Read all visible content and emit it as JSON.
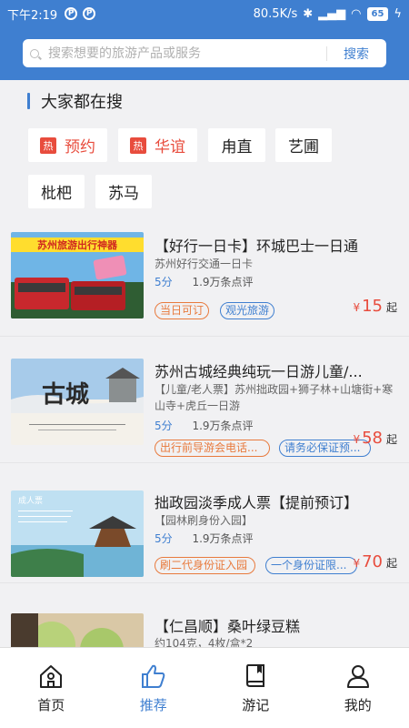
{
  "statusbar": {
    "time": "下午2:19",
    "p1": "P",
    "p2": "P",
    "speed": "80.5K/s",
    "battery": "65"
  },
  "search": {
    "placeholder": "搜索想要的旅游产品或服务",
    "button": "搜索"
  },
  "hot": {
    "title": "大家都在搜",
    "hot_label": "热",
    "chips": [
      "预约",
      "华谊",
      "甪直",
      "艺圃",
      "枇杷",
      "苏马"
    ]
  },
  "items": [
    {
      "title": "【好行一日卡】环城巴士一日通",
      "subtitle": "苏州好行交通一日卡",
      "score": "5分",
      "reviews": "1.9万条点评",
      "tags": [
        "当日可订",
        "观光旅游"
      ],
      "currency": "¥",
      "price": "15",
      "qi": "起",
      "thumb_text": "苏州旅游出行神器"
    },
    {
      "title": "苏州古城经典纯玩一日游儿童/...",
      "subtitle": "【儿童/老人票】苏州拙政园+狮子林+山塘街+寒山寺+虎丘一日游",
      "score": "5分",
      "reviews": "1.9万条点评",
      "tags": [
        "出行前导游会电话...",
        "请务必保证预..."
      ],
      "currency": "¥",
      "price": "58",
      "qi": "起",
      "thumb_text": "古城"
    },
    {
      "title": "拙政园淡季成人票【提前预订】",
      "subtitle": "【园林刷身份入园】",
      "score": "5分",
      "reviews": "1.9万条点评",
      "tags": [
        "刷二代身份证入园",
        "一个身份证限..."
      ],
      "currency": "¥",
      "price": "70",
      "qi": "起",
      "thumb_text": "成人票"
    },
    {
      "title": "【仁昌顺】桑叶绿豆糕",
      "subtitle": "约104克，4枚/盒*2"
    }
  ],
  "nav": [
    {
      "label": "首页",
      "icon": "home-icon"
    },
    {
      "label": "推荐",
      "icon": "thumbs-up-icon"
    },
    {
      "label": "游记",
      "icon": "book-icon"
    },
    {
      "label": "我的",
      "icon": "user-icon"
    }
  ],
  "colors": {
    "brand": "#3f7fd0",
    "price": "#e84c3d",
    "tag_orange": "#e87a3d"
  }
}
